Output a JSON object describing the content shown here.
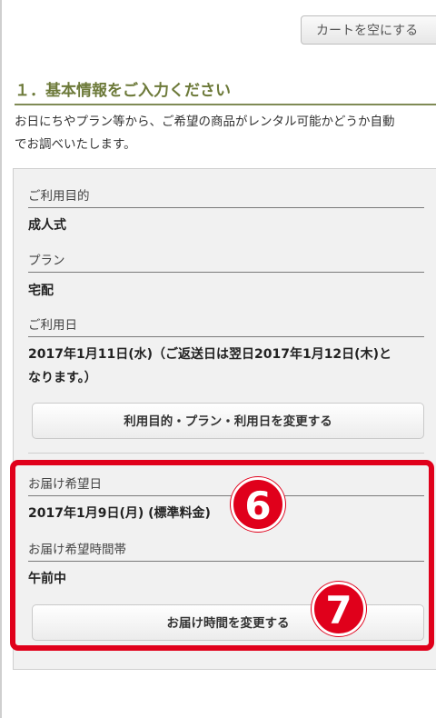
{
  "header": {
    "clear_cart_label": "カートを空にする"
  },
  "section": {
    "title": "１．基本情報をご入力ください",
    "intro_line1": "お日にちやプラン等から、ご希望の商品がレンタル可能かどうか自動",
    "intro_line2": "でお調べいたします。"
  },
  "form": {
    "purpose": {
      "label": "ご利用目的",
      "value": "成人式"
    },
    "plan": {
      "label": "プラン",
      "value": "宅配"
    },
    "date": {
      "label": "ご利用日",
      "value_line1": "2017年1月11日(水)（ご返送日は翌日2017年1月12日(木)と",
      "value_line2": "なります。）"
    },
    "change_button_label": "利用目的・プラン・利用日を変更する",
    "delivery_date": {
      "label": "お届け希望日",
      "value": "2017年1月9日(月) (標準料金)"
    },
    "delivery_time": {
      "label": "お届け希望時間帯",
      "value": "午前中"
    },
    "change_time_button_label": "お届け時間を変更する"
  },
  "annotations": {
    "badge_6": "6",
    "badge_7": "7",
    "highlight_color": "#e0001b"
  }
}
